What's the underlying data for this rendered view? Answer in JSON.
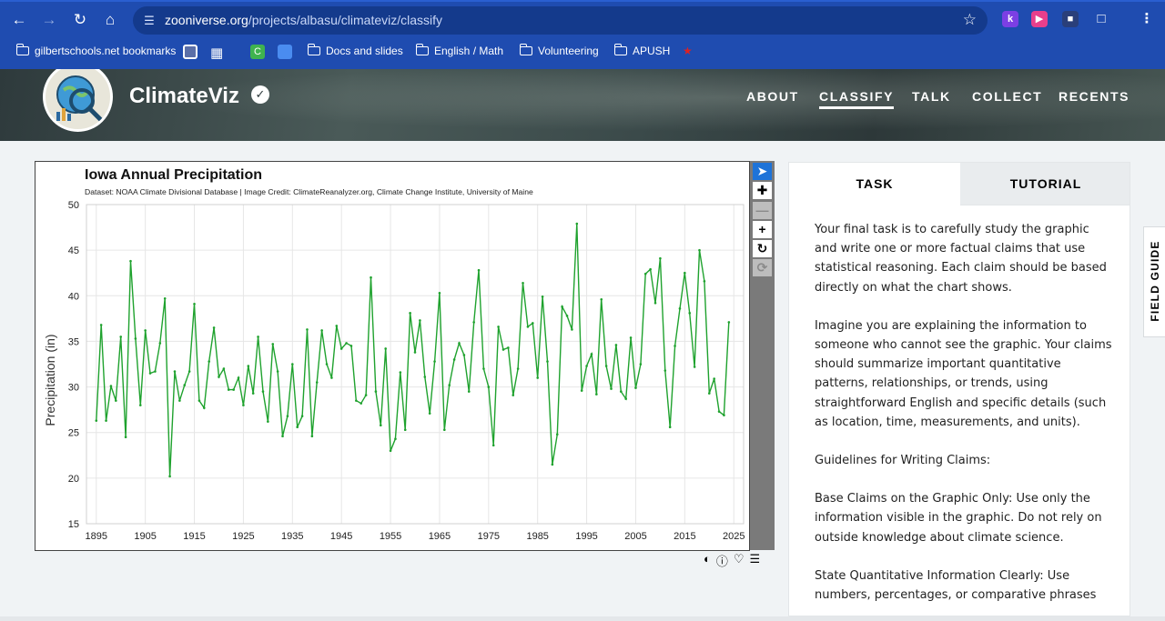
{
  "browser": {
    "url_host": "zooniverse.org",
    "url_path": "/projects/albasu/climateviz/classify",
    "bookmarks": [
      {
        "label": "gilbertschools.net bookmarks"
      },
      {
        "label": "Docs and slides"
      },
      {
        "label": "English / Math"
      },
      {
        "label": "Volunteering"
      },
      {
        "label": "APUSH"
      }
    ],
    "colors": {
      "toolbar": "#1f4cb0",
      "omnibox": "#143a8c"
    }
  },
  "project": {
    "title": "ClimateViz",
    "nav": [
      "ABOUT",
      "CLASSIFY",
      "TALK",
      "COLLECT",
      "RECENTS"
    ],
    "active_nav": "CLASSIFY"
  },
  "chart_data": {
    "type": "line",
    "title": "Iowa Annual Precipitation",
    "subtitle": "Dataset: NOAA Climate Divisional Database | Image Credit: ClimateReanalyzer.org, Climate Change Institute, University of Maine",
    "xlabel": "",
    "ylabel": "Precipitation (in)",
    "xlim": [
      1893,
      2027
    ],
    "ylim": [
      15,
      50
    ],
    "xticks": [
      1895,
      1905,
      1915,
      1925,
      1935,
      1945,
      1955,
      1965,
      1975,
      1985,
      1995,
      2005,
      2015,
      2025
    ],
    "yticks": [
      15,
      20,
      25,
      30,
      35,
      40,
      45,
      50
    ],
    "grid": true,
    "line_color": "#1fa22e",
    "series": [
      {
        "x": [
          1895,
          1896,
          1897,
          1898,
          1899,
          1900,
          1901,
          1902,
          1903,
          1904,
          1905,
          1906,
          1907,
          1908,
          1909,
          1910,
          1911,
          1912,
          1913,
          1914,
          1915,
          1916,
          1917,
          1918,
          1919,
          1920,
          1921,
          1922,
          1923,
          1924,
          1925,
          1926,
          1927,
          1928,
          1929,
          1930,
          1931,
          1932,
          1933,
          1934,
          1935,
          1936,
          1937,
          1938,
          1939,
          1940,
          1941,
          1942,
          1943,
          1944,
          1945,
          1946,
          1947,
          1948,
          1949,
          1950,
          1951,
          1952,
          1953,
          1954,
          1955,
          1956,
          1957,
          1958,
          1959,
          1960,
          1961,
          1962,
          1963,
          1964,
          1965,
          1966,
          1967,
          1968,
          1969,
          1970,
          1971,
          1972,
          1973,
          1974,
          1975,
          1976,
          1977,
          1978,
          1979,
          1980,
          1981,
          1982,
          1983,
          1984,
          1985,
          1986,
          1987,
          1988,
          1989,
          1990,
          1991,
          1992,
          1993,
          1994,
          1995,
          1996,
          1997,
          1998,
          1999,
          2000,
          2001,
          2002,
          2003,
          2004,
          2005,
          2006,
          2007,
          2008,
          2009,
          2010,
          2011,
          2012,
          2013,
          2014,
          2015,
          2016,
          2017,
          2018,
          2019,
          2020,
          2021,
          2022,
          2023,
          2024
        ],
        "values": [
          26.3,
          36.8,
          26.3,
          30.1,
          28.5,
          35.5,
          24.5,
          43.8,
          35.3,
          28.0,
          36.2,
          31.5,
          31.7,
          34.8,
          39.7,
          20.2,
          31.7,
          28.5,
          30.2,
          31.7,
          39.1,
          28.5,
          27.7,
          32.8,
          36.5,
          31.1,
          32.0,
          29.7,
          29.7,
          31.0,
          28.0,
          32.3,
          29.3,
          35.5,
          29.5,
          26.2,
          34.7,
          31.7,
          24.6,
          26.8,
          32.5,
          25.6,
          26.8,
          36.3,
          24.6,
          30.5,
          36.2,
          32.5,
          31.0,
          36.7,
          34.2,
          34.8,
          34.5,
          28.5,
          28.2,
          29.1,
          42.0,
          29.5,
          25.8,
          34.2,
          23.0,
          24.3,
          31.6,
          25.3,
          38.1,
          33.8,
          37.3,
          31.1,
          27.1,
          32.8,
          40.3,
          25.3,
          30.2,
          33.0,
          34.8,
          33.5,
          29.5,
          37.1,
          42.8,
          32.0,
          30.0,
          23.6,
          36.6,
          34.1,
          34.3,
          29.1,
          32.0,
          41.4,
          36.6,
          37.0,
          31.0,
          39.9,
          32.8,
          21.5,
          24.8,
          38.8,
          37.8,
          36.3,
          47.9,
          29.6,
          32.3,
          33.6,
          29.2,
          39.6,
          32.3,
          29.8,
          34.6,
          29.5,
          28.7,
          35.4,
          29.9,
          32.5,
          42.4,
          42.9,
          39.2,
          44.1,
          31.8,
          25.6,
          34.5,
          38.6,
          42.5,
          38.1,
          32.2,
          45.0,
          41.6,
          29.3,
          30.9,
          27.3,
          26.9,
          37.1
        ]
      }
    ]
  },
  "toolbar": {
    "tools": [
      "pointer-tool",
      "pan-tool",
      "zoom-out-tool",
      "zoom-in-tool",
      "rotate-tool",
      "reset-tool"
    ]
  },
  "task_panel": {
    "tabs": [
      "TASK",
      "TUTORIAL"
    ],
    "paragraphs": [
      "Your final task is to carefully study the graphic and write one or more factual claims that use statistical reasoning. Each claim should be based directly on what the chart shows.",
      "Imagine you are explaining the information to someone who cannot see the graphic. Your claims should summarize important quantitative patterns, relationships, or trends, using straightforward English and specific details (such as location, time, measurements, and units).",
      "Guidelines for Writing Claims:",
      "Base Claims on the Graphic Only: Use only the information visible in the graphic. Do not rely on outside knowledge about climate science.",
      "State Quantitative Information Clearly: Use numbers, percentages, or comparative phrases"
    ]
  },
  "field_guide": {
    "label": "FIELD GUIDE"
  }
}
